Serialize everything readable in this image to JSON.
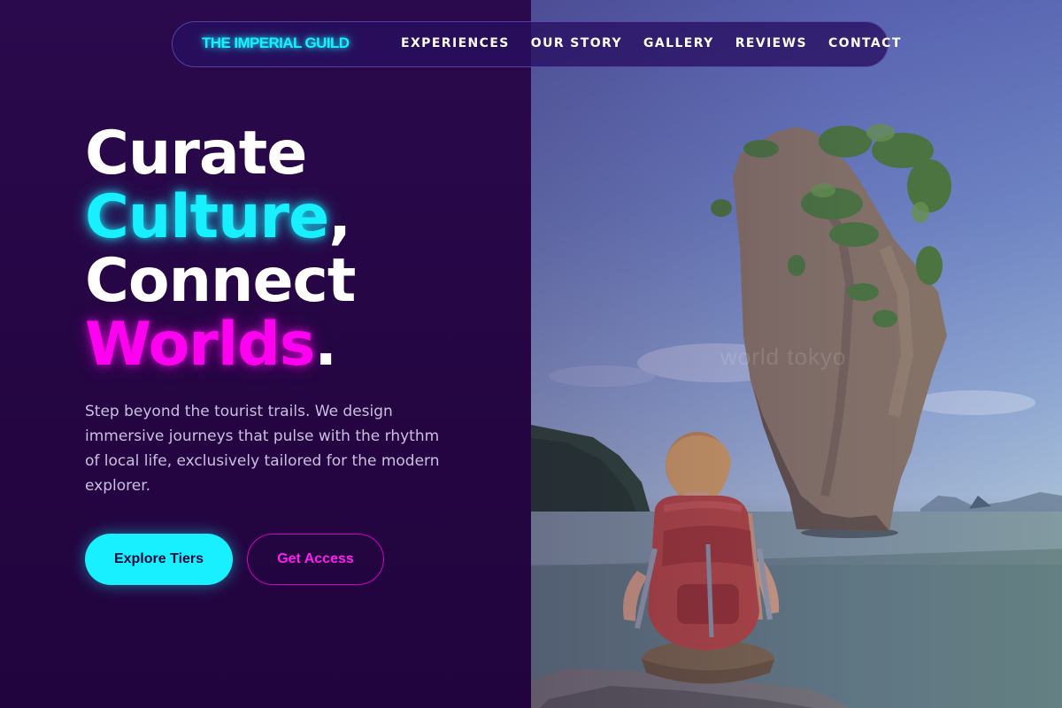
{
  "brand": {
    "name": "THE IMPERIAL GUILD"
  },
  "nav": {
    "links": [
      "EXPERIENCES",
      "OUR STORY",
      "GALLERY",
      "REVIEWS",
      "CONTACT"
    ]
  },
  "hero": {
    "headline": {
      "word1": "Curate",
      "word2": "Culture",
      "comma": ",",
      "word3": "Connect",
      "word4": "Worlds",
      "period": "."
    },
    "lead": "Step beyond the tourist trails. We design immersive journeys that pulse with the rhythm of local life, exclusively tailored for the modern explorer.",
    "primary_cta": "Explore Tiers",
    "secondary_cta": "Get Access"
  },
  "photo": {
    "watermark": "world tokyo",
    "subject": "traveler with red backpack facing limestone sea stack"
  },
  "colors": {
    "background": "#260645",
    "accent_cyan": "#19f0ff",
    "accent_magenta": "#ff00f0",
    "text_muted": "#cbbfe0"
  }
}
